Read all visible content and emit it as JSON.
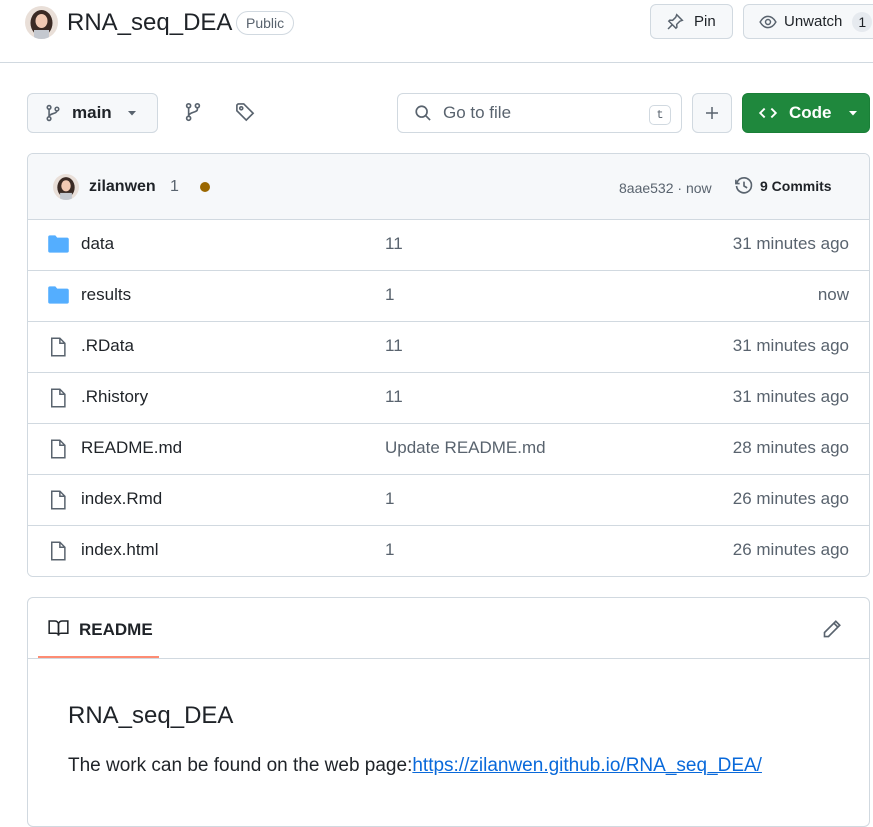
{
  "repo": {
    "name": "RNA_seq_DEA",
    "visibility": "Public",
    "pin_label": "Pin",
    "unwatch_label": "Unwatch",
    "watch_count": "1"
  },
  "toolbar": {
    "branch": "main",
    "search_placeholder": "Go to file",
    "search_shortcut": "t",
    "code_label": "Code"
  },
  "commit": {
    "author": "zilanwen",
    "message": "1",
    "sha_time": "8aae532 · now",
    "commits_label": "9 Commits"
  },
  "files": [
    {
      "type": "folder",
      "name": "data",
      "message": "11",
      "date": "31 minutes ago"
    },
    {
      "type": "folder",
      "name": "results",
      "message": "1",
      "date": "now"
    },
    {
      "type": "file",
      "name": ".RData",
      "message": "11",
      "date": "31 minutes ago"
    },
    {
      "type": "file",
      "name": ".Rhistory",
      "message": "11",
      "date": "31 minutes ago"
    },
    {
      "type": "file",
      "name": "README.md",
      "message": "Update README.md",
      "date": "28 minutes ago"
    },
    {
      "type": "file",
      "name": "index.Rmd",
      "message": "1",
      "date": "26 minutes ago"
    },
    {
      "type": "file",
      "name": "index.html",
      "message": "1",
      "date": "26 minutes ago"
    }
  ],
  "readme": {
    "tab_label": "README",
    "title": "RNA_seq_DEA",
    "text": "The work can be found on the web page:",
    "link": "https://zilanwen.github.io/RNA_seq_DEA/"
  },
  "colors": {
    "code_button": "#1f883d",
    "folder_icon": "#54aeff",
    "status_dot": "#9a6700",
    "tab_underline": "#fd8c73",
    "link": "#0969da"
  }
}
